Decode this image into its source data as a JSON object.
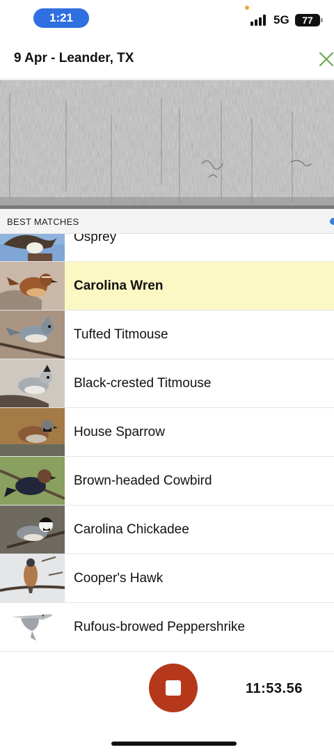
{
  "status_bar": {
    "time": "1:21",
    "network": "5G",
    "battery": "77"
  },
  "header": {
    "title": "9 Apr - Leander, TX",
    "close_icon": "close-x-icon"
  },
  "colors": {
    "accent_green": "#6aa84f",
    "selected_row": "#fbf8c4",
    "stop_button": "#b5381b",
    "time_pill": "#2f6fe0"
  },
  "section": {
    "label": "BEST MATCHES"
  },
  "matches": [
    {
      "name": "Osprey"
    },
    {
      "name": "Carolina Wren",
      "selected": true
    },
    {
      "name": "Tufted Titmouse"
    },
    {
      "name": "Black-crested Titmouse"
    },
    {
      "name": "House Sparrow"
    },
    {
      "name": "Brown-headed Cowbird"
    },
    {
      "name": "Carolina Chickadee"
    },
    {
      "name": "Cooper's Hawk"
    },
    {
      "name": "Rufous-browed Peppershrike"
    }
  ],
  "recording": {
    "elapsed": "11:53.56",
    "stop_icon": "stop-icon"
  }
}
